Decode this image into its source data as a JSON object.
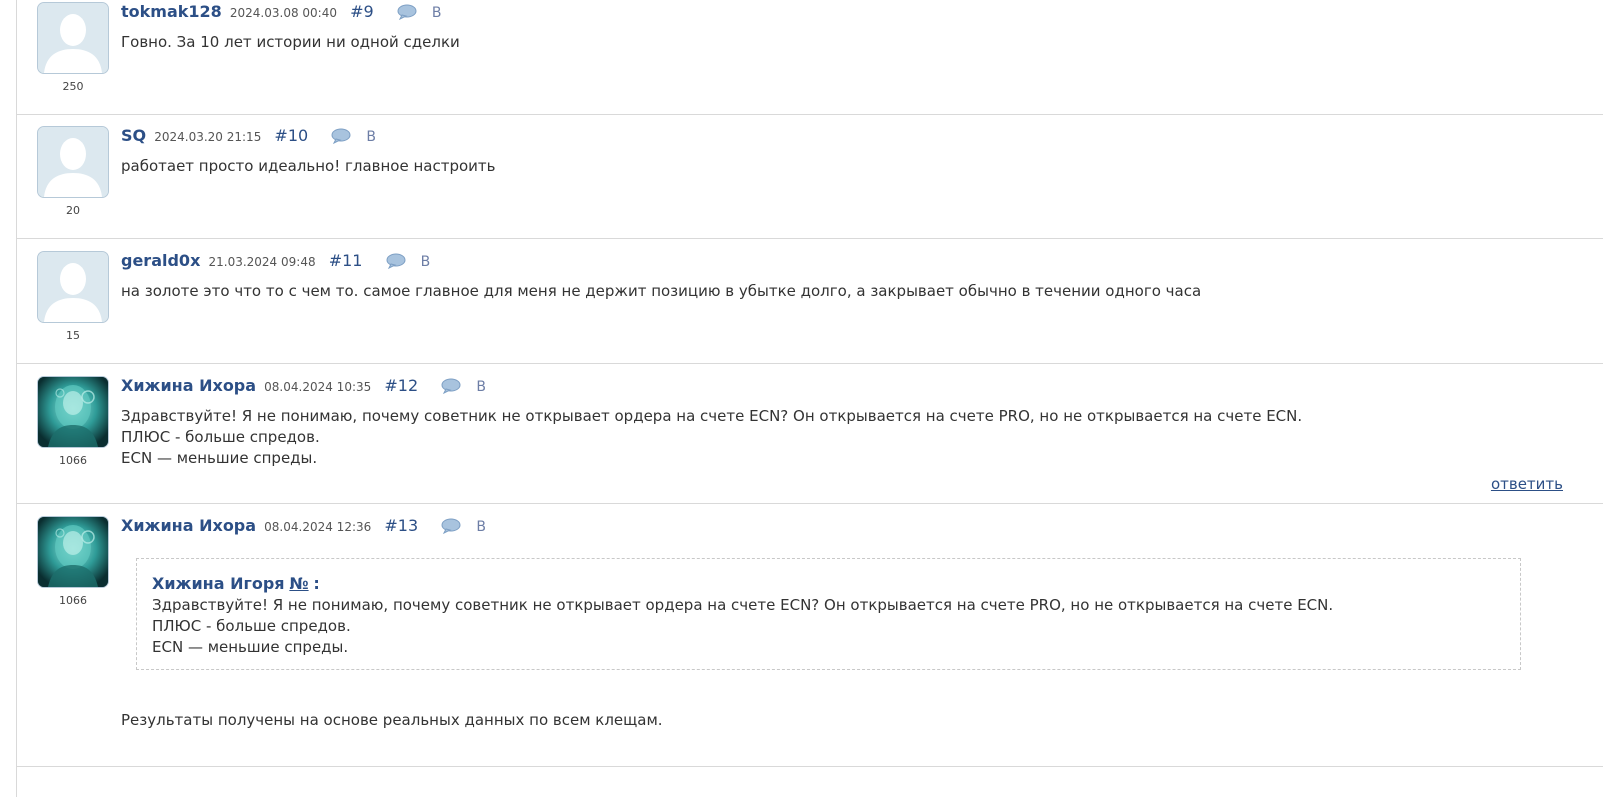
{
  "comments": [
    {
      "author": "tokmak128",
      "date": "2024.03.08 00:40",
      "num": "#9",
      "vote": "В",
      "rating": "250",
      "avatar": "default",
      "lines": [
        "Говно. За 10 лет истории ни одной сделки"
      ]
    },
    {
      "author": "SQ",
      "date": "2024.03.20 21:15",
      "num": "#10",
      "vote": "В",
      "rating": "20",
      "avatar": "default",
      "lines": [
        "работает просто идеально! главное настроить"
      ]
    },
    {
      "author": "gerald0x",
      "date": "21.03.2024 09:48",
      "num": "#11",
      "vote": "В",
      "rating": "15",
      "avatar": "default",
      "lines": [
        "на золоте это что то с чем то. самое главное для меня не держит позицию в убытке долго, а закрывает обычно в течении одного часа"
      ]
    },
    {
      "author": "Хижина Ихора",
      "date": "08.04.2024 10:35",
      "num": "#12",
      "vote": "В",
      "rating": "1066",
      "avatar": "custom",
      "lines": [
        "Здравствуйте! Я не понимаю, почему советник не открывает ордера на счете ECN? Он открывается на счете PRO, но не открывается на счете ECN.",
        "ПЛЮС - больше спредов.",
        "ECN — меньшие спреды."
      ],
      "reply_label": "ответить"
    },
    {
      "author": "Хижина Ихора",
      "date": "08.04.2024 12:36",
      "num": "#13",
      "vote": "В",
      "rating": "1066",
      "avatar": "custom",
      "quote": {
        "author": "Хижина Игоря",
        "num": "№",
        "colon": ":",
        "lines": [
          "Здравствуйте! Я не понимаю, почему советник не открывает ордера на счете ECN? Он открывается на счете PRO, но не открывается на счете ECN.",
          "ПЛЮС - больше спредов.",
          "ECN — меньшие спреды."
        ]
      },
      "lines": [
        "Результаты получены на основе реальных данных по всем клещам."
      ]
    }
  ]
}
